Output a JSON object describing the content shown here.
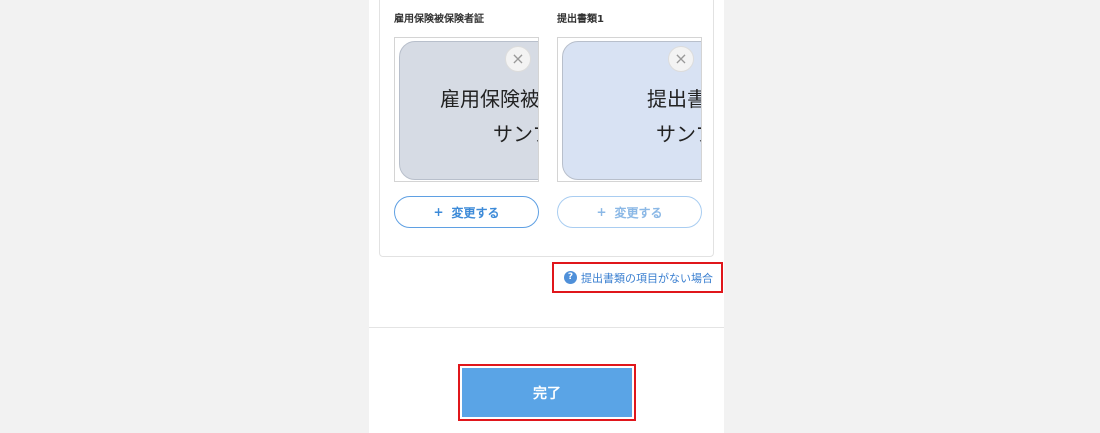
{
  "documents": [
    {
      "title": "雇用保険被保険者証",
      "preview_line1": "雇用保険被",
      "preview_line2": "サンプ",
      "preview_color": "#d6dbe4",
      "change_label": "変更する",
      "remove_glyph": "×"
    },
    {
      "title": "提出書類1",
      "preview_line1": "提出書",
      "preview_line2": "サンプ",
      "preview_color": "#d8e2f3",
      "change_label": "変更する",
      "remove_glyph": "×"
    }
  ],
  "plus_glyph": "+",
  "help_link": {
    "icon": "?",
    "text": "提出書類の項目がない場合"
  },
  "submit": {
    "label": "完了"
  },
  "colors": {
    "accent": "#5aa4e6",
    "highlight": "#e0161b",
    "link": "#3a7fd0"
  }
}
